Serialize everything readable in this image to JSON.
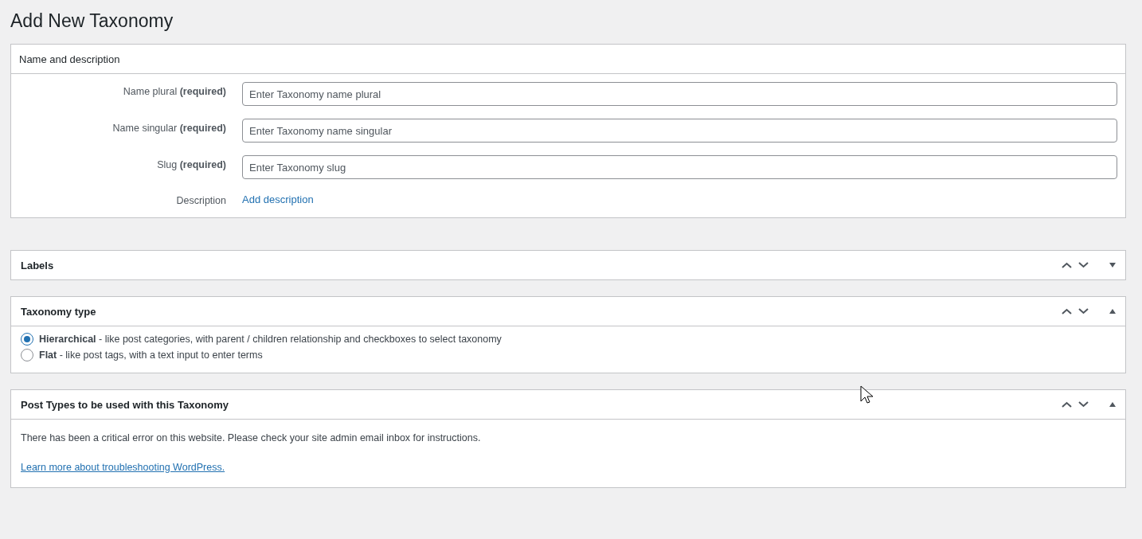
{
  "page_title": "Add New Taxonomy",
  "name_panel": {
    "title": "Name and description",
    "fields": [
      {
        "label": "Name plural **(required)**",
        "placeholder": "Enter Taxonomy name plural"
      },
      {
        "label": "Name singular **(required)**",
        "placeholder": "Enter Taxonomy name singular"
      },
      {
        "label": "Slug **(required)**",
        "placeholder": "Enter Taxonomy slug"
      }
    ],
    "description": {
      "label": "Description",
      "link": "Add description"
    }
  },
  "panels": [
    {
      "title": "Labels",
      "expanded": false
    },
    {
      "kind": "radios",
      "title": "Taxonomy type",
      "expanded": true,
      "options": [
        {
          "text": "**Hierarchical** - like post categories, with parent / children relationship and checkboxes to select taxonomy",
          "selected": true
        },
        {
          "text": "**Flat** - like post tags, with a text input to enter terms",
          "selected": false
        }
      ]
    },
    {
      "kind": "message",
      "title": "Post Types to be used with this Taxonomy",
      "expanded": true,
      "message": "There has been a critical error on this website. Please check your site admin email inbox for instructions.",
      "link": "Learn more about troubleshooting WordPress."
    }
  ]
}
